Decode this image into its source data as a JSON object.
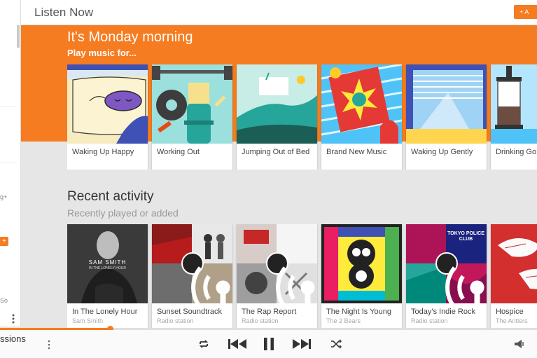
{
  "header": {
    "title": "Listen Now",
    "add_label": "+ A"
  },
  "drawer": {
    "fragments": [
      "g+",
      "So"
    ],
    "plus": "+"
  },
  "hero": {
    "title": "It's Monday morning",
    "subtitle": "Play music for..."
  },
  "activities": [
    {
      "label": "Waking Up Happy"
    },
    {
      "label": "Working Out"
    },
    {
      "label": "Jumping Out of Bed"
    },
    {
      "label": "Brand New Music"
    },
    {
      "label": "Waking Up Gently"
    },
    {
      "label": "Drinking Go Coffee"
    }
  ],
  "recent": {
    "title": "Recent activity",
    "subtitle": "Recently played or added",
    "items": [
      {
        "title": "In The Lonely Hour",
        "subtitle": "Sam Smith",
        "cover_text": "SAM SMITH",
        "cover_sub": "IN THE LONELY HOUR"
      },
      {
        "title": "Sunset Soundtrack",
        "subtitle": "Radio station"
      },
      {
        "title": "The Rap Report",
        "subtitle": "Radio station"
      },
      {
        "title": "The Night Is Young",
        "subtitle": "The 2 Bears"
      },
      {
        "title": "Today's Indie Rock",
        "subtitle": "Radio station",
        "cover_text": "TOKYO POLICE CLUB"
      },
      {
        "title": "Hospice",
        "subtitle": "The Antlers"
      }
    ]
  },
  "player": {
    "now_playing": "ssions",
    "progress_fraction": 0.205
  },
  "colors": {
    "accent": "#f57c20",
    "background": "#e6e6e6"
  },
  "icons": [
    "repeat-icon",
    "skip-previous-icon",
    "pause-icon",
    "skip-next-icon",
    "shuffle-icon",
    "volume-icon",
    "more-vert-icon",
    "radio-station-icon"
  ]
}
